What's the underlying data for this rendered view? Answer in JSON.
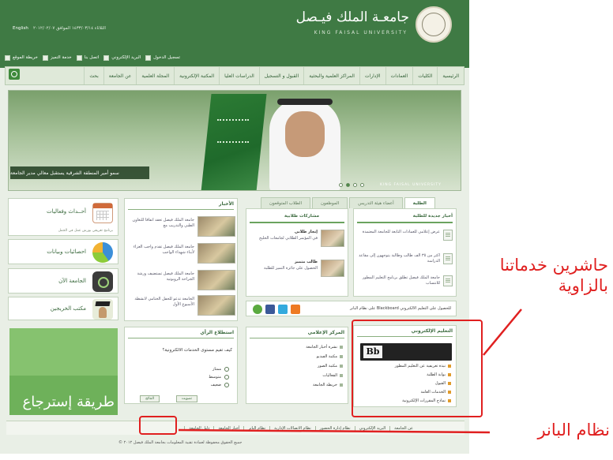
{
  "header": {
    "university_name_ar": "جامعـة الملك فيـصل",
    "university_name_en": "KING FAISAL UNIVERSITY",
    "date_line": "الثلاثاء ١٤٣٣/٠٣/١٤ الموافق ٢٠١٢/٠٢/٠٧",
    "language_link": "English",
    "utility_links": [
      "تسجيل الدخول",
      "البريد الإلكتروني",
      "اتصل بنا",
      "خدمة التميز",
      "خريطة الموقع"
    ]
  },
  "nav": {
    "items": [
      "الرئيسية",
      "الكليات",
      "العمادات",
      "الإدارات",
      "المراكز العلمية والبحثية",
      "القبول و التسجيل",
      "الدراسات العليا",
      "المكتبة الإلكترونية",
      "المجلة العلمية",
      "عن الجامعة",
      "بحث"
    ]
  },
  "hero": {
    "caption": "سمو أمير المنطقة الشرقية يستقبل معالي مدير الجامعة",
    "watermark": "KING FAISAL UNIVERSITY",
    "slide_count": 4,
    "active_slide": 2
  },
  "audience_tabs": [
    "الطلبة",
    "أعضاء هيئة التدريس",
    "الموظفون",
    "الطلاب المتوقعون"
  ],
  "services": [
    {
      "label": "أحــداث وفعاليات",
      "sub": "برنامج تعريفي بورش عمل في الجمل",
      "icon": "calendar-icon"
    },
    {
      "label": "احصائيات وبيانات",
      "icon": "pie-chart-icon"
    },
    {
      "label": "الجامعة الآن",
      "icon": "camera-icon"
    },
    {
      "label": "مكتب الخريجين",
      "icon": "graduate-icon"
    }
  ],
  "news": {
    "title": "الأخبار",
    "items": [
      "جامعة الملك فيصل تعقد اتفاقا للتعاون الطبي والتدريب مع",
      "جامعة الملك فيصل تقدم واجب العزاء لأبناء شهداء الواجب",
      "جامعة الملك فيصل تستضيف ورشة الجراحة الروبوتية",
      "الجامعة تدعو للحفل الختامي لأنشطة الأسبوع الأول"
    ]
  },
  "announcements": {
    "title": "أخبار جديدة للطلبة",
    "items": [
      "عرض إعلامي للعمادات التابعة للجامعة المعتمدة",
      "أكثر من ٣٥ ألف طالب وطالبة يتوجهون إلى مقاعد الدراسة",
      "جامعة الملك فيصل تطلق برنامج التعليم المطور للانتساب"
    ]
  },
  "student_projects": {
    "title": "مشاركات طلابية",
    "items": [
      {
        "title": "إنجاز طلابي",
        "text": "في المؤتمر الطلابي لجامعات الخليج"
      },
      {
        "title": "طالب متميز",
        "text": "الحصول على جائزة التميز للطلبة"
      }
    ]
  },
  "social_bar": {
    "notice": "للحصول على التعليم الالكتروني Blackboard على نظام البانر"
  },
  "poll": {
    "title": "استطلاع الرأي",
    "question": "كيف تقيم مستوى الخدمات الالكترونية؟",
    "options": [
      "ممتاز",
      "متوسط",
      "ضعيف"
    ],
    "vote_label": "تصويت",
    "results_label": "النتائج"
  },
  "media_center": {
    "title": "المركز الإعلامي",
    "items": [
      "نشرة أخبار الجامعة",
      "مكتبة الفيديو",
      "مكتبة الصور",
      "الفعاليات",
      "خريطة الجامعة"
    ]
  },
  "elearning": {
    "title": "التعليم الإلكتروني",
    "items": [
      "نبذة تعريفية عن التعليم المطور",
      "بوابة الطلبة",
      "القبول",
      "الخدمات العامة",
      "نماذج المقررات الإلكترونية"
    ]
  },
  "ad_banner": {
    "text": "طريقة إسترجاع"
  },
  "footer": {
    "links": [
      "عن الجامعة",
      "البريد الإلكتروني",
      "نظام إدارة الحضور",
      "نظام الاتصالات الإدارية",
      "نظام البانر",
      "أخبار الجامعة",
      "دليل الجامعة"
    ],
    "copyright": "جميع الحقوق محفوظة لعمادة تقنية المعلومات بجامعة الملك فيصل ٢٠١٢ ©"
  },
  "annotations": {
    "elearning_note": "حاشرين خدماتنا بالزاوية",
    "banner_note": "نظام البانر",
    "color": "#e02020"
  },
  "colors": {
    "header_green": "#3f7a44",
    "accent_green": "#6aa35e",
    "annotation_red": "#e02020"
  }
}
